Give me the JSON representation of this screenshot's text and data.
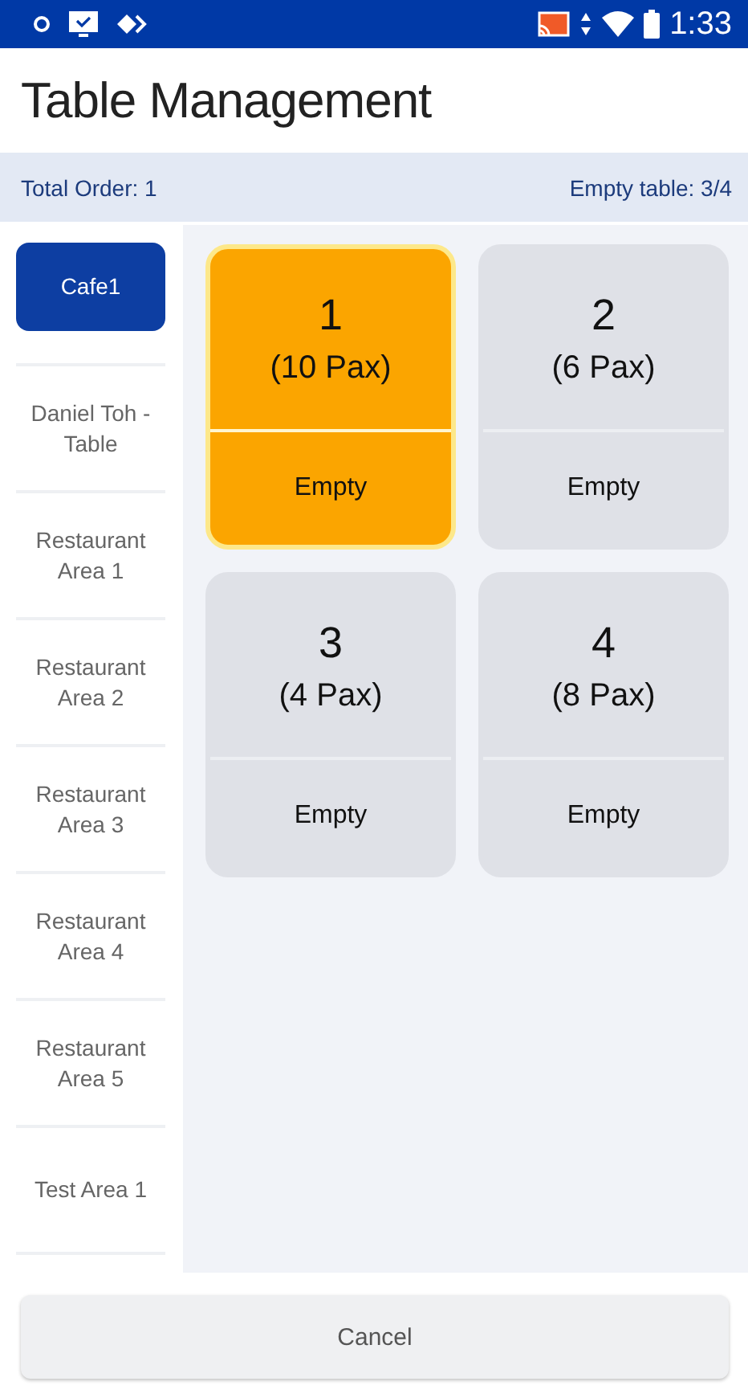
{
  "status_bar": {
    "time": "1:33"
  },
  "title": "Table Management",
  "summary": {
    "total_order": "Total Order: 1",
    "empty_tables": "Empty table: 3/4"
  },
  "areas": [
    {
      "label": "Cafe1",
      "selected": true
    },
    {
      "label": "Daniel Toh - Table",
      "selected": false
    },
    {
      "label": "Restaurant Area 1",
      "selected": false
    },
    {
      "label": "Restaurant Area 2",
      "selected": false
    },
    {
      "label": "Restaurant Area 3",
      "selected": false
    },
    {
      "label": "Restaurant Area 4",
      "selected": false
    },
    {
      "label": "Restaurant Area 5",
      "selected": false
    },
    {
      "label": "Test Area 1",
      "selected": false
    }
  ],
  "tables": [
    {
      "number": "1",
      "pax": "(10 Pax)",
      "status": "Empty",
      "selected": true
    },
    {
      "number": "2",
      "pax": "(6 Pax)",
      "status": "Empty",
      "selected": false
    },
    {
      "number": "3",
      "pax": "(4 Pax)",
      "status": "Empty",
      "selected": false
    },
    {
      "number": "4",
      "pax": "(8 Pax)",
      "status": "Empty",
      "selected": false
    }
  ],
  "cancel_button": "Cancel"
}
